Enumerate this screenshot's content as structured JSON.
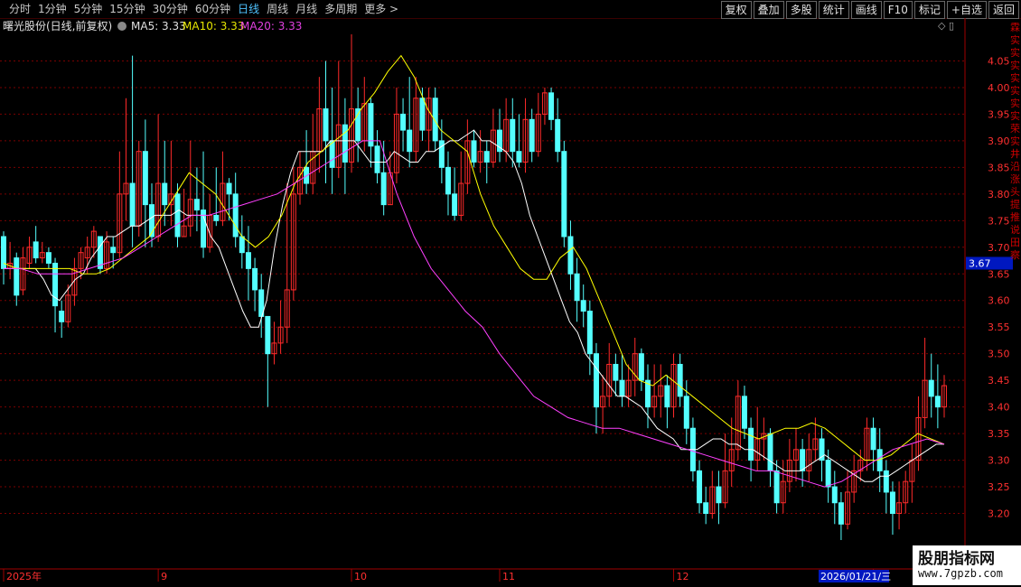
{
  "toolbar": {
    "tabs": [
      "分时",
      "1分钟",
      "5分钟",
      "15分钟",
      "30分钟",
      "60分钟",
      "日线",
      "周线",
      "月线",
      "多周期",
      "更多 >"
    ],
    "active_tab": "日线",
    "right_buttons": [
      "复权",
      "叠加",
      "多股",
      "统计",
      "画线",
      "F10",
      "标记",
      "+自选",
      "返回"
    ]
  },
  "info": {
    "title": "曙光股份(日线,前复权)",
    "ma5": "MA5: 3.33",
    "ma10": "MA10: 3.33",
    "ma20": "MA20: 3.33",
    "controls": "◇ ▯"
  },
  "colors": {
    "up": "#ff2a2a",
    "down": "#54ffff",
    "ma5": "#ffffff",
    "ma10": "#ffff00",
    "ma20": "#ff40ff",
    "grid": "#7a0000",
    "axis_text": "#ff3030",
    "price_box": "#0018c0"
  },
  "current_price_label": "3.67",
  "date_box": "2026/01/21/三",
  "right_side_labels": [
    "霖",
    "实",
    "实",
    "实",
    "实",
    "实",
    "实",
    "实",
    "荣",
    "实",
    "井",
    "沿",
    "涨",
    "头",
    "提",
    "推",
    "说",
    "田",
    "察"
  ],
  "watermark": {
    "line1": "股朋指标网",
    "line2": "www.7gpzb.com"
  },
  "chart_data": {
    "type": "candlestick",
    "title": "曙光股份(日线,前复权)",
    "y_ticks": [
      3.2,
      3.25,
      3.3,
      3.35,
      3.4,
      3.45,
      3.5,
      3.55,
      3.6,
      3.65,
      3.7,
      3.75,
      3.8,
      3.85,
      3.9,
      3.95,
      4.0,
      4.05
    ],
    "ylim": [
      3.15,
      4.1
    ],
    "x_labels": [
      {
        "label": "2025年",
        "index": 0
      },
      {
        "label": "9",
        "index": 24
      },
      {
        "label": "10",
        "index": 54
      },
      {
        "label": "11",
        "index": 77
      },
      {
        "label": "12",
        "index": 104
      },
      {
        "label": "1",
        "index": 135
      }
    ],
    "candles": [
      [
        3.72,
        3.66,
        3.63,
        3.73
      ],
      [
        3.66,
        3.67,
        3.64,
        3.71
      ],
      [
        3.68,
        3.61,
        3.59,
        3.69
      ],
      [
        3.62,
        3.68,
        3.61,
        3.7
      ],
      [
        3.67,
        3.7,
        3.66,
        3.72
      ],
      [
        3.71,
        3.68,
        3.67,
        3.74
      ],
      [
        3.68,
        3.69,
        3.67,
        3.71
      ],
      [
        3.69,
        3.67,
        3.66,
        3.7
      ],
      [
        3.67,
        3.59,
        3.54,
        3.68
      ],
      [
        3.58,
        3.56,
        3.53,
        3.6
      ],
      [
        3.56,
        3.61,
        3.55,
        3.63
      ],
      [
        3.61,
        3.66,
        3.59,
        3.68
      ],
      [
        3.66,
        3.69,
        3.64,
        3.7
      ],
      [
        3.68,
        3.7,
        3.65,
        3.72
      ],
      [
        3.7,
        3.73,
        3.68,
        3.74
      ],
      [
        3.72,
        3.66,
        3.65,
        3.71
      ],
      [
        3.66,
        3.71,
        3.65,
        3.73
      ],
      [
        3.7,
        3.69,
        3.66,
        3.72
      ],
      [
        3.69,
        3.8,
        3.68,
        3.88
      ],
      [
        3.8,
        3.82,
        3.75,
        3.98
      ],
      [
        3.82,
        3.74,
        3.7,
        4.06
      ],
      [
        3.74,
        3.88,
        3.72,
        3.9
      ],
      [
        3.88,
        3.78,
        3.7,
        3.94
      ],
      [
        3.78,
        3.72,
        3.7,
        3.82
      ],
      [
        3.72,
        3.82,
        3.71,
        3.95
      ],
      [
        3.82,
        3.78,
        3.74,
        3.9
      ],
      [
        3.78,
        3.8,
        3.74,
        3.9
      ],
      [
        3.8,
        3.72,
        3.7,
        3.82
      ],
      [
        3.72,
        3.74,
        3.72,
        3.81
      ],
      [
        3.74,
        3.79,
        3.72,
        3.9
      ],
      [
        3.79,
        3.77,
        3.73,
        3.85
      ],
      [
        3.77,
        3.7,
        3.68,
        3.88
      ],
      [
        3.7,
        3.76,
        3.69,
        3.8
      ],
      [
        3.76,
        3.75,
        3.74,
        3.85
      ],
      [
        3.75,
        3.82,
        3.74,
        3.88
      ],
      [
        3.82,
        3.8,
        3.75,
        3.83
      ],
      [
        3.8,
        3.72,
        3.7,
        3.84
      ],
      [
        3.72,
        3.69,
        3.66,
        3.76
      ],
      [
        3.69,
        3.66,
        3.6,
        3.74
      ],
      [
        3.66,
        3.62,
        3.58,
        3.68
      ],
      [
        3.62,
        3.57,
        3.53,
        3.65
      ],
      [
        3.57,
        3.5,
        3.4,
        3.55
      ],
      [
        3.5,
        3.52,
        3.48,
        3.56
      ],
      [
        3.52,
        3.55,
        3.5,
        3.6
      ],
      [
        3.55,
        3.62,
        3.52,
        3.82
      ],
      [
        3.62,
        3.8,
        3.6,
        3.85
      ],
      [
        3.8,
        3.85,
        3.78,
        3.88
      ],
      [
        3.85,
        3.82,
        3.8,
        3.92
      ],
      [
        3.82,
        3.88,
        3.8,
        3.95
      ],
      [
        3.88,
        3.96,
        3.84,
        4.02
      ],
      [
        3.96,
        3.9,
        3.82,
        4.05
      ],
      [
        3.9,
        3.85,
        3.8,
        4.0
      ],
      [
        3.85,
        3.93,
        3.83,
        4.05
      ],
      [
        3.93,
        3.86,
        3.8,
        3.98
      ],
      [
        3.86,
        3.96,
        3.84,
        4.1
      ],
      [
        3.96,
        3.9,
        3.86,
        4.0
      ],
      [
        3.9,
        3.97,
        3.88,
        4.02
      ],
      [
        3.97,
        3.89,
        3.85,
        3.98
      ],
      [
        3.89,
        3.84,
        3.82,
        3.92
      ],
      [
        3.84,
        3.78,
        3.76,
        3.9
      ],
      [
        3.78,
        3.84,
        3.78,
        3.88
      ],
      [
        3.84,
        3.95,
        3.82,
        4.0
      ],
      [
        3.95,
        3.92,
        3.88,
        3.98
      ],
      [
        3.92,
        3.88,
        3.85,
        4.02
      ],
      [
        3.88,
        3.98,
        3.86,
        4.02
      ],
      [
        3.98,
        3.92,
        3.9,
        4.0
      ],
      [
        3.92,
        3.98,
        3.88,
        4.0
      ],
      [
        3.98,
        3.9,
        3.88,
        4.0
      ],
      [
        3.9,
        3.85,
        3.82,
        3.94
      ],
      [
        3.85,
        3.8,
        3.76,
        3.88
      ],
      [
        3.8,
        3.76,
        3.75,
        3.85
      ],
      [
        3.76,
        3.82,
        3.75,
        3.88
      ],
      [
        3.82,
        3.9,
        3.8,
        3.94
      ],
      [
        3.9,
        3.86,
        3.85,
        3.92
      ],
      [
        3.86,
        3.88,
        3.84,
        3.92
      ],
      [
        3.88,
        3.86,
        3.82,
        3.9
      ],
      [
        3.86,
        3.92,
        3.85,
        3.96
      ],
      [
        3.92,
        3.88,
        3.86,
        3.96
      ],
      [
        3.88,
        3.94,
        3.86,
        3.98
      ],
      [
        3.94,
        3.88,
        3.85,
        3.98
      ],
      [
        3.88,
        3.86,
        3.85,
        3.95
      ],
      [
        3.86,
        3.94,
        3.84,
        3.98
      ],
      [
        3.94,
        3.88,
        3.86,
        3.96
      ],
      [
        3.88,
        3.95,
        3.87,
        3.99
      ],
      [
        3.95,
        3.99,
        3.93,
        4.0
      ],
      [
        3.99,
        3.94,
        3.92,
        4.0
      ],
      [
        3.94,
        3.88,
        3.86,
        3.98
      ],
      [
        3.88,
        3.72,
        3.7,
        3.9
      ],
      [
        3.72,
        3.65,
        3.62,
        3.75
      ],
      [
        3.65,
        3.6,
        3.56,
        3.68
      ],
      [
        3.6,
        3.58,
        3.55,
        3.63
      ],
      [
        3.58,
        3.5,
        3.46,
        3.6
      ],
      [
        3.5,
        3.4,
        3.35,
        3.52
      ],
      [
        3.4,
        3.42,
        3.35,
        3.46
      ],
      [
        3.42,
        3.48,
        3.4,
        3.52
      ],
      [
        3.48,
        3.45,
        3.42,
        3.5
      ],
      [
        3.45,
        3.42,
        3.4,
        3.5
      ],
      [
        3.42,
        3.45,
        3.4,
        3.48
      ],
      [
        3.45,
        3.5,
        3.42,
        3.53
      ],
      [
        3.5,
        3.45,
        3.43,
        3.51
      ],
      [
        3.45,
        3.4,
        3.36,
        3.48
      ],
      [
        3.4,
        3.42,
        3.38,
        3.48
      ],
      [
        3.42,
        3.44,
        3.38,
        3.48
      ],
      [
        3.44,
        3.4,
        3.36,
        3.46
      ],
      [
        3.4,
        3.48,
        3.38,
        3.5
      ],
      [
        3.48,
        3.42,
        3.4,
        3.5
      ],
      [
        3.42,
        3.36,
        3.33,
        3.45
      ],
      [
        3.36,
        3.28,
        3.26,
        3.38
      ],
      [
        3.28,
        3.22,
        3.2,
        3.3
      ],
      [
        3.22,
        3.2,
        3.18,
        3.25
      ],
      [
        3.2,
        3.25,
        3.19,
        3.28
      ],
      [
        3.25,
        3.22,
        3.18,
        3.28
      ],
      [
        3.22,
        3.28,
        3.21,
        3.35
      ],
      [
        3.28,
        3.32,
        3.25,
        3.38
      ],
      [
        3.32,
        3.42,
        3.3,
        3.45
      ],
      [
        3.42,
        3.36,
        3.34,
        3.44
      ],
      [
        3.36,
        3.3,
        3.26,
        3.38
      ],
      [
        3.3,
        3.34,
        3.28,
        3.4
      ],
      [
        3.34,
        3.35,
        3.3,
        3.38
      ],
      [
        3.35,
        3.28,
        3.25,
        3.36
      ],
      [
        3.28,
        3.22,
        3.2,
        3.3
      ],
      [
        3.22,
        3.26,
        3.2,
        3.3
      ],
      [
        3.26,
        3.3,
        3.24,
        3.34
      ],
      [
        3.3,
        3.32,
        3.26,
        3.36
      ],
      [
        3.32,
        3.28,
        3.25,
        3.34
      ],
      [
        3.28,
        3.32,
        3.26,
        3.35
      ],
      [
        3.32,
        3.34,
        3.3,
        3.38
      ],
      [
        3.34,
        3.3,
        3.26,
        3.36
      ],
      [
        3.3,
        3.25,
        3.22,
        3.32
      ],
      [
        3.25,
        3.22,
        3.18,
        3.28
      ],
      [
        3.22,
        3.18,
        3.15,
        3.24
      ],
      [
        3.18,
        3.24,
        3.17,
        3.28
      ],
      [
        3.24,
        3.28,
        3.22,
        3.31
      ],
      [
        3.28,
        3.3,
        3.26,
        3.32
      ],
      [
        3.3,
        3.36,
        3.28,
        3.38
      ],
      [
        3.36,
        3.32,
        3.28,
        3.38
      ],
      [
        3.32,
        3.28,
        3.24,
        3.36
      ],
      [
        3.28,
        3.24,
        3.2,
        3.3
      ],
      [
        3.24,
        3.2,
        3.16,
        3.26
      ],
      [
        3.2,
        3.22,
        3.17,
        3.26
      ],
      [
        3.22,
        3.26,
        3.2,
        3.28
      ],
      [
        3.26,
        3.3,
        3.22,
        3.33
      ],
      [
        3.3,
        3.38,
        3.28,
        3.42
      ],
      [
        3.38,
        3.45,
        3.36,
        3.53
      ],
      [
        3.45,
        3.42,
        3.38,
        3.5
      ],
      [
        3.42,
        3.4,
        3.36,
        3.48
      ],
      [
        3.4,
        3.44,
        3.38,
        3.46
      ]
    ],
    "ma5": [
      3.66,
      3.66,
      3.66,
      3.66,
      3.66,
      3.64,
      3.61,
      3.6,
      3.62,
      3.64,
      3.65,
      3.68,
      3.7,
      3.72,
      3.72,
      3.73,
      3.74,
      3.74,
      3.75,
      3.76,
      3.76,
      3.76,
      3.77,
      3.76,
      3.76,
      3.76,
      3.72,
      3.7,
      3.66,
      3.62,
      3.58,
      3.55,
      3.55,
      3.6,
      3.7,
      3.78,
      3.84,
      3.88,
      3.88,
      3.88,
      3.88,
      3.9,
      3.9,
      3.9,
      3.9,
      3.88,
      3.86,
      3.86,
      3.86,
      3.88,
      3.87,
      3.86,
      3.86,
      3.88,
      3.88,
      3.89,
      3.9,
      3.9,
      3.91,
      3.92,
      3.9,
      3.9,
      3.89,
      3.88,
      3.86,
      3.82,
      3.76,
      3.72,
      3.68,
      3.64,
      3.6,
      3.56,
      3.54,
      3.5,
      3.48,
      3.46,
      3.44,
      3.42,
      3.42,
      3.41,
      3.4,
      3.38,
      3.36,
      3.35,
      3.34,
      3.32,
      3.32,
      3.32,
      3.33,
      3.34,
      3.34,
      3.33,
      3.33,
      3.32,
      3.32,
      3.31,
      3.3,
      3.29,
      3.28,
      3.28,
      3.28,
      3.29,
      3.3,
      3.31,
      3.3,
      3.29,
      3.28,
      3.27,
      3.26,
      3.26,
      3.27,
      3.27,
      3.28,
      3.29,
      3.3,
      3.31,
      3.32,
      3.33,
      3.33
    ],
    "ma10": [
      3.67,
      3.66,
      3.66,
      3.66,
      3.66,
      3.66,
      3.65,
      3.65,
      3.66,
      3.68,
      3.7,
      3.72,
      3.76,
      3.8,
      3.84,
      3.82,
      3.8,
      3.76,
      3.72,
      3.7,
      3.72,
      3.76,
      3.82,
      3.86,
      3.88,
      3.9,
      3.92,
      3.96,
      3.99,
      4.03,
      4.06,
      4.02,
      3.96,
      3.92,
      3.9,
      3.88,
      3.8,
      3.74,
      3.7,
      3.66,
      3.64,
      3.64,
      3.68,
      3.7,
      3.66,
      3.6,
      3.54,
      3.48,
      3.45,
      3.44,
      3.46,
      3.44,
      3.42,
      3.4,
      3.38,
      3.36,
      3.35,
      3.34,
      3.35,
      3.36,
      3.36,
      3.37,
      3.36,
      3.34,
      3.32,
      3.3,
      3.3,
      3.31,
      3.33,
      3.35,
      3.34,
      3.33
    ],
    "ma20": [
      3.66,
      3.66,
      3.65,
      3.65,
      3.65,
      3.66,
      3.67,
      3.68,
      3.7,
      3.72,
      3.74,
      3.76,
      3.76,
      3.77,
      3.78,
      3.79,
      3.8,
      3.82,
      3.84,
      3.86,
      3.88,
      3.9,
      3.9,
      3.8,
      3.72,
      3.66,
      3.62,
      3.58,
      3.55,
      3.5,
      3.46,
      3.42,
      3.4,
      3.38,
      3.37,
      3.36,
      3.36,
      3.35,
      3.34,
      3.33,
      3.32,
      3.31,
      3.3,
      3.29,
      3.28,
      3.28,
      3.27,
      3.26,
      3.25,
      3.26,
      3.28,
      3.3,
      3.32,
      3.33,
      3.34,
      3.33
    ]
  }
}
